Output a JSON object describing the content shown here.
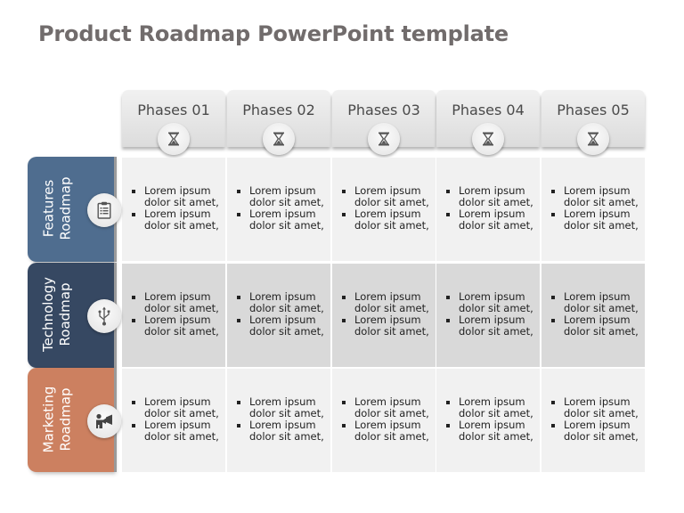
{
  "title": "Product Roadmap PowerPoint template",
  "colors": {
    "features": "#4f6d8f",
    "technology": "#364862",
    "marketing": "#cc8060"
  },
  "phases": [
    {
      "label": "Phases 01",
      "icon": "hourglass-icon"
    },
    {
      "label": "Phases 02",
      "icon": "hourglass-icon"
    },
    {
      "label": "Phases 03",
      "icon": "hourglass-icon"
    },
    {
      "label": "Phases 04",
      "icon": "hourglass-icon"
    },
    {
      "label": "Phases 05",
      "icon": "hourglass-icon"
    }
  ],
  "rows": [
    {
      "label_line1": "Features",
      "label_line2": "Roadmap",
      "icon": "clipboard-icon",
      "cells": [
        [
          "Lorem ipsum dolor sit amet,",
          "Lorem ipsum dolor sit amet,"
        ],
        [
          "Lorem ipsum dolor sit amet,",
          "Lorem ipsum dolor sit amet,"
        ],
        [
          "Lorem ipsum dolor sit amet,",
          "Lorem ipsum dolor sit amet,"
        ],
        [
          "Lorem ipsum dolor sit amet,",
          "Lorem ipsum dolor sit amet,"
        ],
        [
          "Lorem ipsum dolor sit amet,",
          "Lorem ipsum dolor sit amet,"
        ]
      ]
    },
    {
      "label_line1": "Technology",
      "label_line2": "Roadmap",
      "icon": "usb-icon",
      "cells": [
        [
          "Lorem ipsum dolor sit amet,",
          "Lorem ipsum dolor sit amet,"
        ],
        [
          "Lorem ipsum dolor sit amet,",
          "Lorem ipsum dolor sit amet,"
        ],
        [
          "Lorem ipsum dolor sit amet,",
          "Lorem ipsum dolor sit amet,"
        ],
        [
          "Lorem ipsum dolor sit amet,",
          "Lorem ipsum dolor sit amet,"
        ],
        [
          "Lorem ipsum dolor sit amet,",
          "Lorem ipsum dolor sit amet,"
        ]
      ]
    },
    {
      "label_line1": "Marketing",
      "label_line2": "Roadmap",
      "icon": "megaphone-person-icon",
      "cells": [
        [
          "Lorem ipsum dolor sit amet,",
          "Lorem ipsum dolor sit amet,"
        ],
        [
          "Lorem ipsum dolor sit amet,",
          "Lorem ipsum dolor sit amet,"
        ],
        [
          "Lorem ipsum dolor sit amet,",
          "Lorem ipsum dolor sit amet,"
        ],
        [
          "Lorem ipsum dolor sit amet,",
          "Lorem ipsum dolor sit amet,"
        ],
        [
          "Lorem ipsum dolor sit amet,",
          "Lorem ipsum dolor sit amet,"
        ]
      ]
    }
  ]
}
